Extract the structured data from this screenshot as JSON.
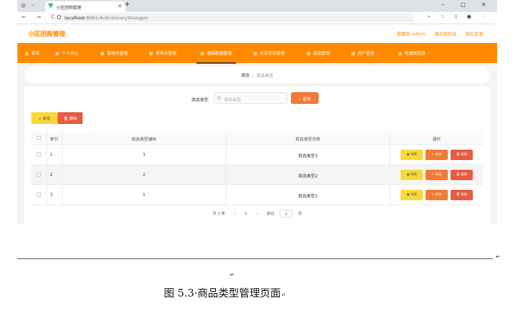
{
  "browser": {
    "tab_title": "小区团购管理",
    "tab_close": "×",
    "new_tab": "+",
    "nav": "← → C",
    "url_host": "localhost",
    "url_path": ":8081/#/dictionaryShangpin",
    "window_controls": "‒ ▢ ✕",
    "toolbar_icons": "⌕ ☆ ▯ ● ⋮"
  },
  "app": {
    "title": "小区团购管理",
    "role_user": "管理员 admin",
    "link_backend": "退出到前台",
    "link_logout": "退出登录"
  },
  "menu": [
    {
      "label": "首页",
      "name": "menu-home"
    },
    {
      "label": "个人中心",
      "name": "menu-profile"
    },
    {
      "label": "管理员管理",
      "name": "menu-admin"
    },
    {
      "label": "采购员管理",
      "name": "menu-buyer"
    },
    {
      "label": "基础数据管理",
      "name": "menu-basic-data"
    },
    {
      "label": "公告信息管理",
      "name": "menu-notice"
    },
    {
      "label": "商品管理",
      "name": "menu-product"
    },
    {
      "label": "用户管理",
      "name": "menu-user"
    },
    {
      "label": "轮播图信息",
      "name": "menu-carousel"
    }
  ],
  "breadcrumb": {
    "home": "首页",
    "separator": "/",
    "current": "商品类型"
  },
  "search": {
    "label": "商品类型",
    "placeholder": "商品类型",
    "button": "查询"
  },
  "actions": {
    "add": "+ 新增",
    "delete": "🗑 删除"
  },
  "table": {
    "headers": {
      "index": "索引",
      "code": "商品类型编码",
      "name": "商品类型名称",
      "op": "操作"
    },
    "rows": [
      {
        "index": "1",
        "code": "3",
        "name": "商品类型3"
      },
      {
        "index": "2",
        "code": "2",
        "name": "商品类型2"
      },
      {
        "index": "3",
        "code": "1",
        "name": "商品类型1"
      }
    ],
    "op_labels": {
      "detail": "详情",
      "edit": "修改",
      "delete": "删除"
    }
  },
  "pagination": {
    "total": "共 3 条",
    "prev": "<",
    "page": "1",
    "next": ">",
    "goto_label": "前往",
    "goto_value": "1",
    "page_unit": "页"
  },
  "document": {
    "mark1": "↵",
    "mark2": "↵",
    "caption": "图 5.3·商品类型管理页面",
    "caption_mark": "↵"
  },
  "colors": {
    "accent": "#ff8a00",
    "query": "#f07a36",
    "danger": "#ea5a3f",
    "warning": "#f9d83a"
  }
}
